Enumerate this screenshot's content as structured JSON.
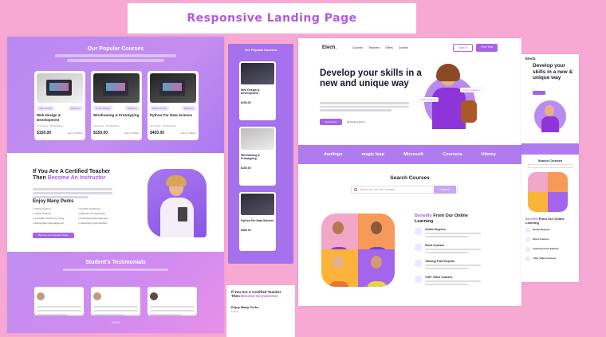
{
  "banner": {
    "title": "Responsive Landing Page"
  },
  "left_page": {
    "courses_title": "Our Popular Courses",
    "courses": [
      {
        "tag": "Web Design",
        "level": "Beginner",
        "name": "Web Design & Development",
        "lessons": "10 Course",
        "students": "60 Students",
        "price": "$150.00",
        "author": "Jemmy Wilson"
      },
      {
        "tag": "UI/UX Design",
        "level": "Beginner",
        "name": "Wireframing & Prototyping",
        "lessons": "10 Course",
        "students": "60 Students",
        "price": "$150.00",
        "author": "Jemmy Wilson"
      },
      {
        "tag": "Data Science",
        "level": "Beginner",
        "name": "Python For Data Science",
        "lessons": "10 Course",
        "students": "60 Students",
        "price": "$450.00",
        "author": "Jemmy Wilson"
      }
    ],
    "instructor": {
      "title_a": "If You Are A Certified Teacher Then",
      "title_b": "Become An Instructor",
      "perks_title": "Enjoy Many Perks",
      "perks": [
        "Online Support",
        "Flexible Timeframe",
        "Online Support",
        "Maintain Your Expertise",
        "Innovative Teach Any Thing",
        "Professional Development",
        "Recognition & Engagement",
        "Networking Opportunities"
      ],
      "button": "Become an Instructor Today"
    },
    "testimonials_title": "Student's Testimonials",
    "pager": "01/02"
  },
  "mobile1": {
    "title": "Our Popular Courses",
    "cards": [
      {
        "name": "Web Design & Development",
        "price": "$150.00"
      },
      {
        "name": "Wireframing & Prototyping",
        "price": "$150.00"
      },
      {
        "name": "Python For Data Science",
        "price": "$450.00"
      }
    ]
  },
  "mobile2": {
    "title_a": "If You Are A Certified Teacher Then",
    "title_b": "Become An Instructor",
    "perks_title": "Enjoy Many Perks"
  },
  "main": {
    "logo": "Etech.",
    "nav": [
      "Courses",
      "Teachers",
      "Offers",
      "Contact"
    ],
    "sign_in": "Sign In",
    "free_trial": "Free Trial",
    "hero_title": "Develop your skills in a new and unique way",
    "hero_btn": "Enroll Now",
    "hero_btn2": "What is Etech",
    "tags": [
      "Online Classes",
      "Online Teachers"
    ],
    "brands": [
      "duolingo",
      "magic leap",
      "Microsoft",
      "Coursera",
      "Udemy"
    ],
    "search_title": "Search Courses",
    "search_placeholder": "Search for over 50+ courses",
    "search_btn": "Search",
    "benefit_title_a": "Benefits",
    "benefit_title_b": "From Our Online Learning",
    "benefits": [
      "Online Degrees",
      "Short Courses",
      "Training From Experts",
      "1.5k+ Video Courses"
    ]
  },
  "tablet": {
    "logo": "Etech.",
    "hero_title": "Develop your skills in a new & unique way",
    "search_title": "Search Courses",
    "benefit_title_a": "Benefits",
    "benefit_title_b": "From Our Online Learning",
    "benefits": [
      "Online Degrees",
      "Short Courses",
      "Learning From Experts",
      "1.5k+ Video Courses"
    ]
  }
}
